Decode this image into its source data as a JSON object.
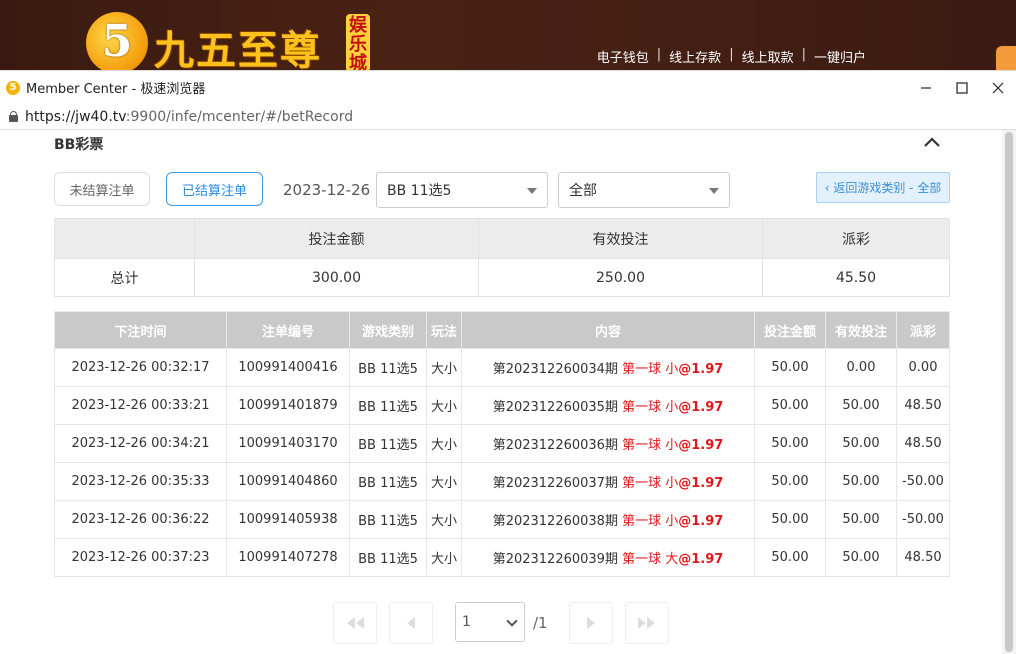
{
  "banner": {
    "logo_number": "5",
    "logo_text": "九五至尊",
    "logo_tag": "娱乐城",
    "links": [
      "电子钱包",
      "线上存款",
      "线上取款",
      "一键归户"
    ]
  },
  "window": {
    "title": "Member Center - 极速浏览器",
    "url_host": "https://jw40.tv",
    "url_rest": ":9900/infe/mcenter/#/betRecord"
  },
  "page": {
    "section_title": "BB彩票",
    "unsettled_label": "未结算注单",
    "settled_label": "已结算注单",
    "date": "2023-12-26",
    "game_select": "BB 11选5",
    "type_select": "全部",
    "back_label": "‹ 返回游戏类别 - 全部"
  },
  "summary": {
    "headers": [
      "",
      "投注金额",
      "有效投注",
      "派彩"
    ],
    "row": [
      "总计",
      "300.00",
      "250.00",
      "45.50"
    ]
  },
  "bets": {
    "headers": [
      "下注时间",
      "注单编号",
      "游戏类别",
      "玩法",
      "内容",
      "投注金额",
      "有效投注",
      "派彩"
    ],
    "rows": [
      {
        "time": "2023-12-26 00:32:17",
        "id": "100991400416",
        "game": "BB 11选5",
        "play": "大小",
        "period": "第202312260034期",
        "pick": "第一球 小",
        "odds": "@1.97",
        "amount": "50.00",
        "valid": "0.00",
        "payout": "0.00"
      },
      {
        "time": "2023-12-26 00:33:21",
        "id": "100991401879",
        "game": "BB 11选5",
        "play": "大小",
        "period": "第202312260035期",
        "pick": "第一球 小",
        "odds": "@1.97",
        "amount": "50.00",
        "valid": "50.00",
        "payout": "48.50"
      },
      {
        "time": "2023-12-26 00:34:21",
        "id": "100991403170",
        "game": "BB 11选5",
        "play": "大小",
        "period": "第202312260036期",
        "pick": "第一球 小",
        "odds": "@1.97",
        "amount": "50.00",
        "valid": "50.00",
        "payout": "48.50"
      },
      {
        "time": "2023-12-26 00:35:33",
        "id": "100991404860",
        "game": "BB 11选5",
        "play": "大小",
        "period": "第202312260037期",
        "pick": "第一球 小",
        "odds": "@1.97",
        "amount": "50.00",
        "valid": "50.00",
        "payout": "-50.00"
      },
      {
        "time": "2023-12-26 00:36:22",
        "id": "100991405938",
        "game": "BB 11选5",
        "play": "大小",
        "period": "第202312260038期",
        "pick": "第一球 小",
        "odds": "@1.97",
        "amount": "50.00",
        "valid": "50.00",
        "payout": "-50.00"
      },
      {
        "time": "2023-12-26 00:37:23",
        "id": "100991407278",
        "game": "BB 11选5",
        "play": "大小",
        "period": "第202312260039期",
        "pick": "第一球 大",
        "odds": "@1.97",
        "amount": "50.00",
        "valid": "50.00",
        "payout": "48.50"
      }
    ]
  },
  "pager": {
    "current": "1",
    "total": "/1"
  }
}
